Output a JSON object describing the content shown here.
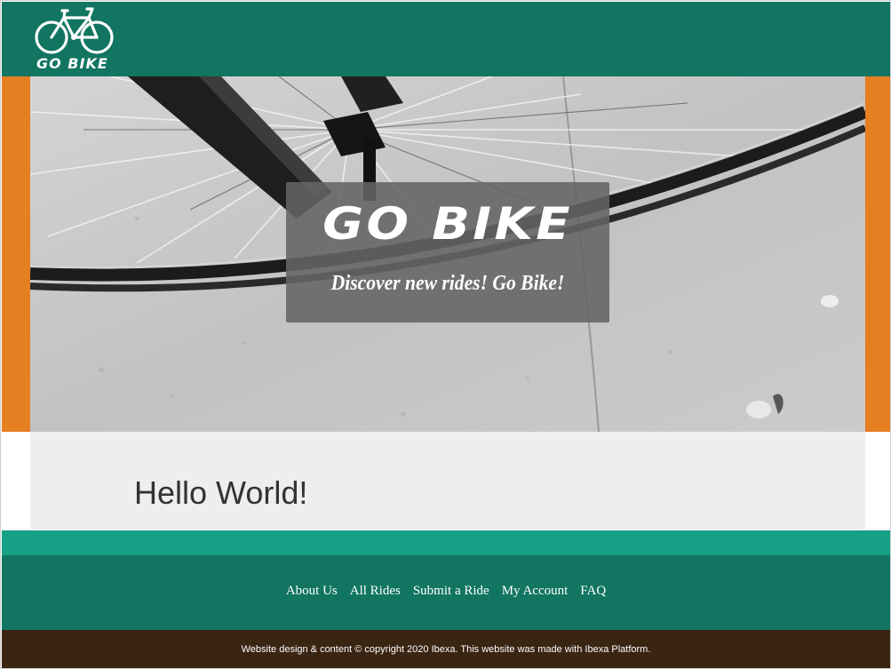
{
  "header": {
    "logo_text": "GO BIKE"
  },
  "hero": {
    "title": "GO BIKE",
    "tagline": "Discover new rides! Go Bike!"
  },
  "main": {
    "heading": "Hello World!"
  },
  "footer": {
    "nav": [
      {
        "label": "About Us"
      },
      {
        "label": "All Rides"
      },
      {
        "label": "Submit a Ride"
      },
      {
        "label": "My Account"
      },
      {
        "label": "FAQ"
      }
    ],
    "copyright": "Website design & content © copyright 2020 Ibexa. This website was made with Ibexa Platform."
  },
  "colors": {
    "header_green": "#117561",
    "accent_orange": "#e67e22",
    "teal_strip": "#17a085",
    "copyright_brown": "#3a2412",
    "content_bg": "#eceef0"
  }
}
